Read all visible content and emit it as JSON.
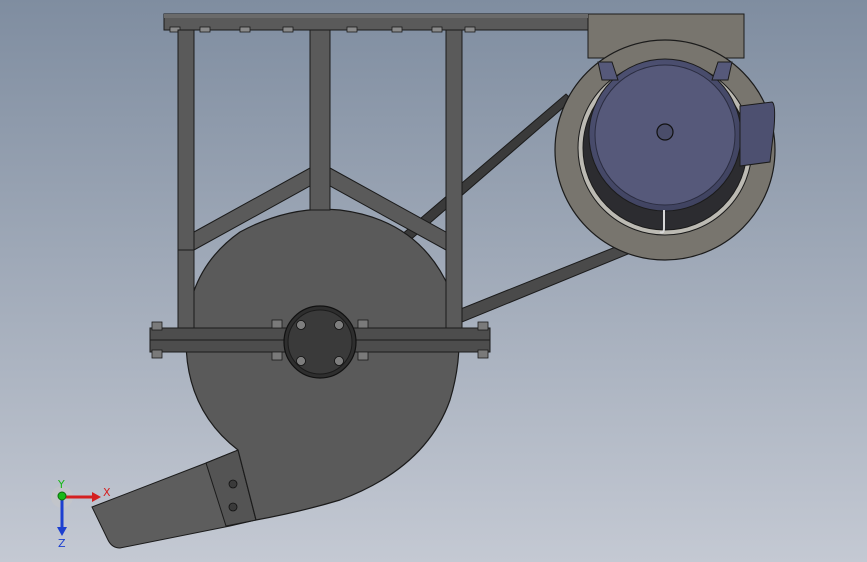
{
  "viewport": {
    "background_top": "#7f8da0",
    "background_bottom": "#c4c9d3"
  },
  "model": {
    "frame_color": "#5a5a5a",
    "frame_dark": "#3e3e3e",
    "edge_color": "#1b1b1b",
    "motor_housing_color": "#78756e",
    "motor_body_color": "#56597a",
    "motor_body_dark": "#3b3e5a",
    "belt_color": "#3a3a3a",
    "hub_color": "#2e2e2e"
  },
  "triad": {
    "x_label": "X",
    "y_label": "Y",
    "z_label": "Z",
    "x_color": "#d42020",
    "y_color": "#18b818",
    "z_color": "#1c3fd0"
  }
}
